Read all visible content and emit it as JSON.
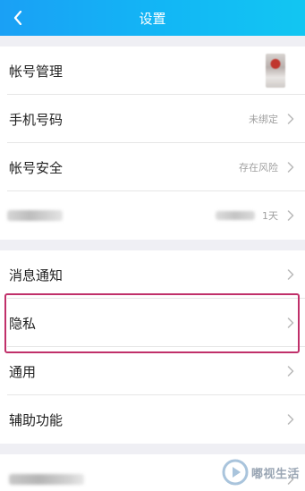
{
  "header": {
    "title": "设置"
  },
  "account_group": {
    "items": [
      {
        "label": "帐号管理",
        "value": ""
      },
      {
        "label": "手机号码",
        "value": "未绑定"
      },
      {
        "label": "帐号安全",
        "value": "存在风险"
      },
      {
        "label": "",
        "value": "1天"
      }
    ]
  },
  "general_group": {
    "items": [
      {
        "label": "消息通知"
      },
      {
        "label": "隐私"
      },
      {
        "label": "通用"
      },
      {
        "label": "辅助功能"
      }
    ]
  },
  "watermark": {
    "text": "嘟视生活",
    "icon": "play-logo-icon"
  },
  "colors": {
    "header_start": "#1aa0f5",
    "header_end": "#12c6f2",
    "highlight": "#c0306a"
  }
}
